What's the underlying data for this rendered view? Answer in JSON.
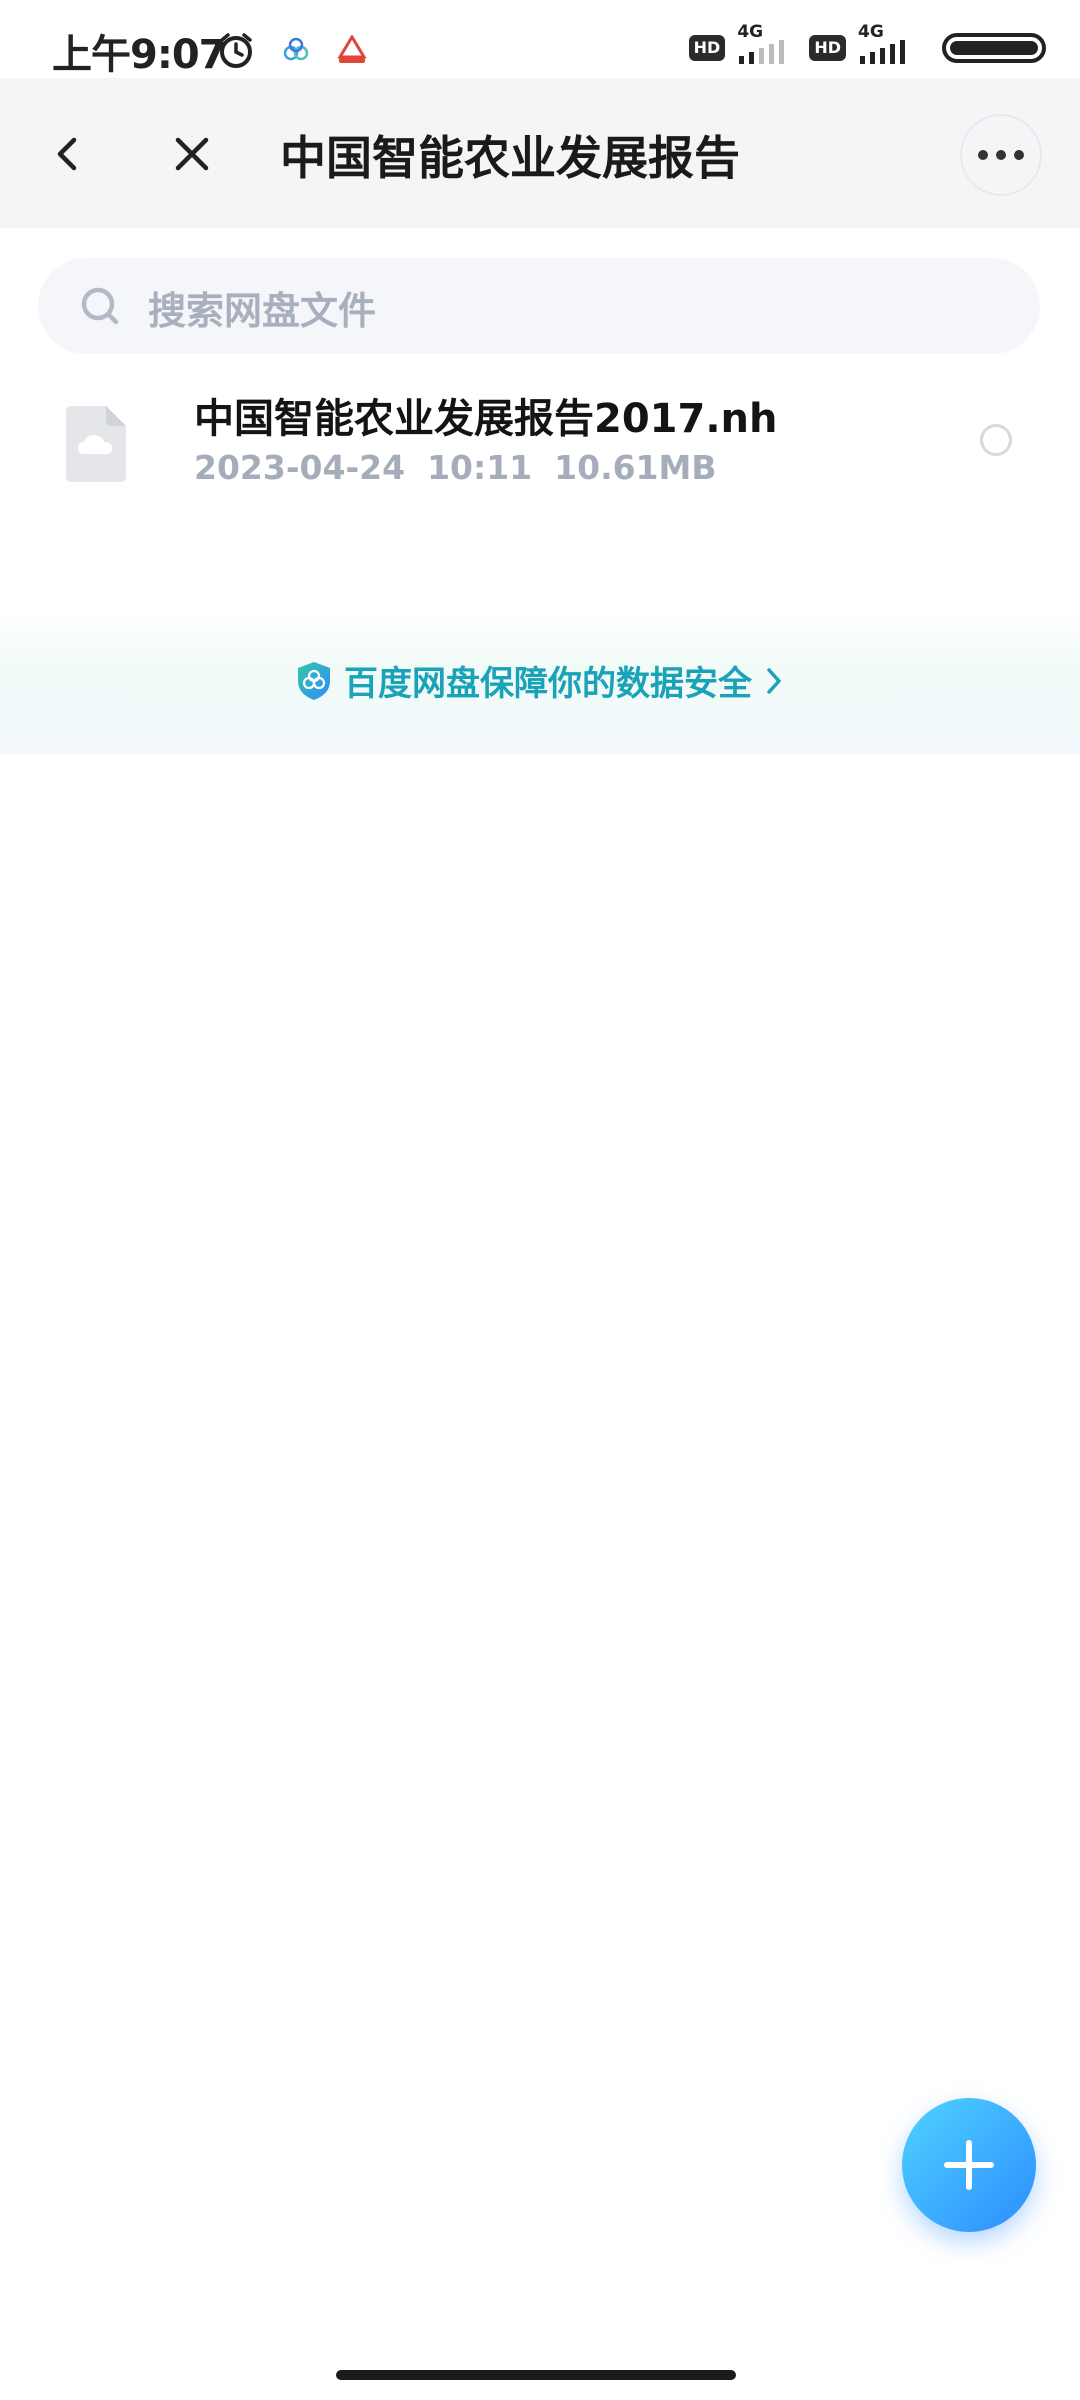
{
  "status_bar": {
    "time": "上午9:07",
    "left_icons": [
      "alarm-icon",
      "baidu-netdisk-icon",
      "app-notification-icon"
    ],
    "network": [
      {
        "badge": "HD",
        "type": "4G"
      },
      {
        "badge": "HD",
        "type": "4G"
      }
    ],
    "battery_level": 1.0
  },
  "header": {
    "title": "中国智能农业发展报告",
    "back_icon": "chevron-left-icon",
    "close_icon": "close-icon",
    "more_icon": "more-horizontal-icon"
  },
  "search": {
    "placeholder": "搜索网盘文件",
    "icon": "search-icon"
  },
  "files": [
    {
      "name": "中国智能农业发展报告2017.nh",
      "date": "2023-04-24",
      "time": "10:11",
      "size": "10.61MB",
      "icon": "cloud-file-icon",
      "selected": false
    }
  ],
  "security_banner": {
    "text": "百度网盘保障你的数据安全",
    "icon": "shield-icon",
    "accent_color": "#1aa3b8"
  },
  "fab": {
    "icon": "plus-icon",
    "color": "#2d8cff"
  }
}
